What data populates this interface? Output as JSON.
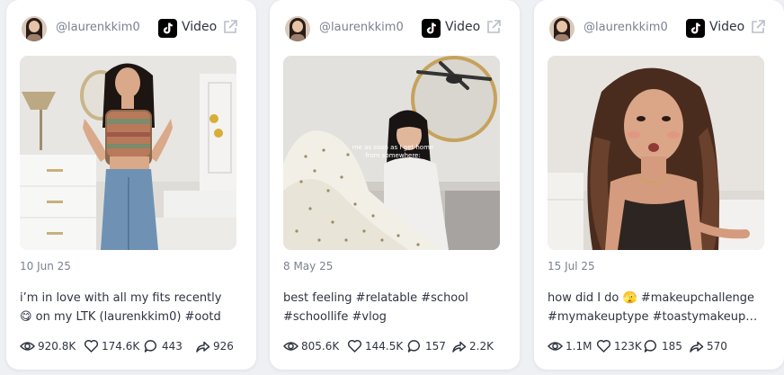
{
  "posts": [
    {
      "handle": "@laurenkkim0",
      "platform": "Video",
      "date": "10 Jun 25",
      "caption": "i’m in love with all my fits recently 😋 on my LTK (laurenkkim0) #ootd #outfitinsp…",
      "views": "920.8K",
      "likes": "174.6K",
      "comments": "443",
      "shares": "926"
    },
    {
      "handle": "@laurenkkim0",
      "platform": "Video",
      "date": "8 May 25",
      "caption": "best feeling #relatable #school #schoollife #vlog #afterschoolroutine…",
      "overlay_text": "me as soon as I get home from somewhere:",
      "views": "805.6K",
      "likes": "144.5K",
      "comments": "157",
      "shares": "2.2K"
    },
    {
      "handle": "@laurenkkim0",
      "platform": "Video",
      "date": "15 Jul 25",
      "caption": "how did I do 🫣 #makeupchallenge #mymakeuptype #toastymakeup…",
      "views": "1.1M",
      "likes": "123K",
      "comments": "185",
      "shares": "570"
    }
  ],
  "colors": {
    "card_bg": "#ffffff",
    "page_bg": "#eef0f4",
    "muted_text": "#7a8190",
    "text": "#2f3441"
  }
}
